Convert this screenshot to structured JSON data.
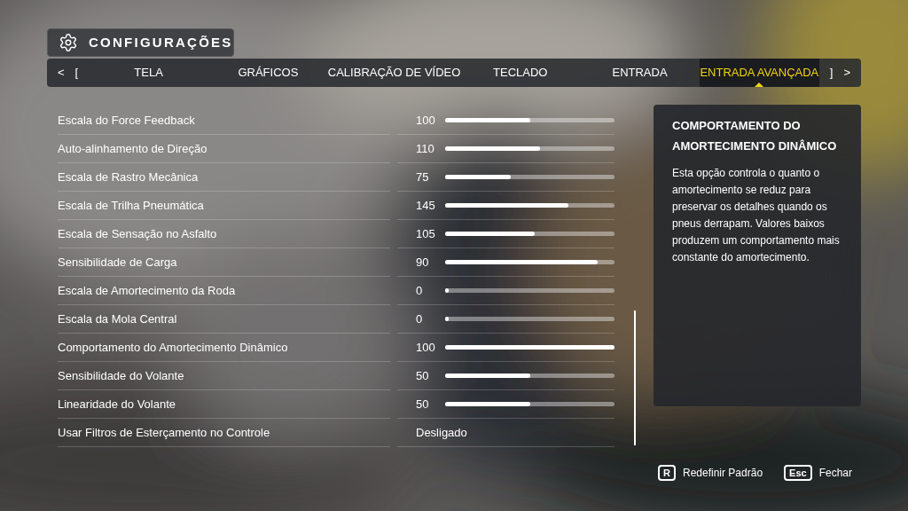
{
  "header": {
    "title": "CONFIGURAÇÕES"
  },
  "tab_bar": {
    "prev_hints": [
      "<",
      "["
    ],
    "next_hints": [
      "]",
      ">"
    ],
    "tabs": [
      {
        "label": "TELA",
        "selected": false
      },
      {
        "label": "GRÁFICOS",
        "selected": false
      },
      {
        "label": "CALIBRAÇÃO DE VÍDEO",
        "selected": false
      },
      {
        "label": "TECLADO",
        "selected": false
      },
      {
        "label": "ENTRADA",
        "selected": false
      },
      {
        "label": "ENTRADA AVANÇADA",
        "selected": true
      }
    ]
  },
  "settings": [
    {
      "kind": "slider",
      "label": "Escala do Force Feedback",
      "value": "100",
      "level": 0.5
    },
    {
      "kind": "slider",
      "label": "Auto-alinhamento de Direção",
      "value": "110",
      "level": 0.56
    },
    {
      "kind": "slider",
      "label": "Escala de Rastro Mecânica",
      "value": "75",
      "level": 0.39
    },
    {
      "kind": "slider",
      "label": "Escala de Trilha Pneumática",
      "value": "145",
      "level": 0.73
    },
    {
      "kind": "slider",
      "label": "Escala de Sensação no Asfalto",
      "value": "105",
      "level": 0.53
    },
    {
      "kind": "slider",
      "label": "Sensibilidade de Carga",
      "value": "90",
      "level": 0.9
    },
    {
      "kind": "slider",
      "label": "Escala de Amortecimento da Roda",
      "value": "0",
      "level": 0.02
    },
    {
      "kind": "slider",
      "label": "Escala da Mola Central",
      "value": "0",
      "level": 0.02
    },
    {
      "kind": "slider",
      "label": "Comportamento do Amortecimento Dinâmico",
      "value": "100",
      "level": 1
    },
    {
      "kind": "slider",
      "label": "Sensibilidade do Volante",
      "value": "50",
      "level": 0.5
    },
    {
      "kind": "slider",
      "label": "Linearidade do Volante",
      "value": "50",
      "level": 0.5
    },
    {
      "kind": "option",
      "label": "Usar Filtros de Esterçamento no Controle",
      "value": "Desligado"
    }
  ],
  "help_panel": {
    "title": "COMPORTAMENTO DO AMORTECIMENTO DINÂMICO",
    "text": "Esta opção controla o quanto o amortecimento se reduz para preservar os detalhes quando os pneus derrapam. Valores baixos produzem um comportamento mais constante do amortecimento."
  },
  "footer": [
    {
      "key": "R",
      "label": "Redefinir Padrão"
    },
    {
      "key": "Esc",
      "label": "Fechar"
    }
  ]
}
